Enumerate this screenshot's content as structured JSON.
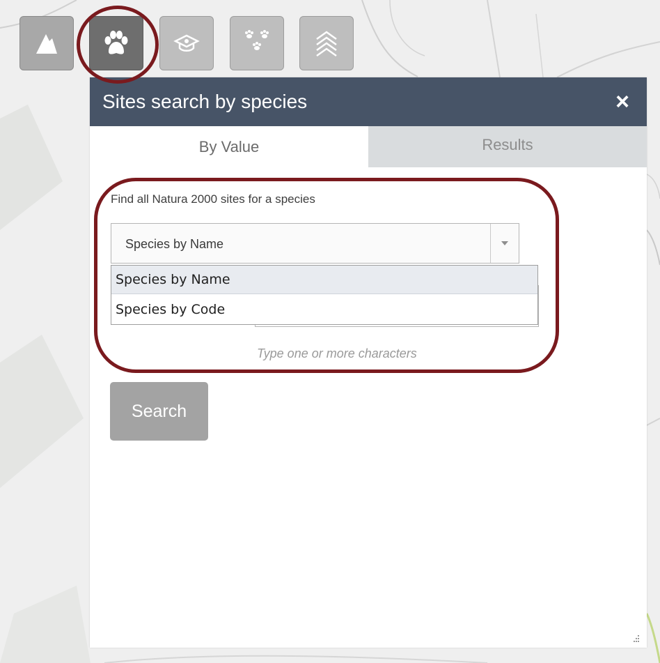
{
  "toolbar": {
    "tools": [
      {
        "icon": "mountain-icon",
        "active": false
      },
      {
        "icon": "paw-icon",
        "active": true
      },
      {
        "icon": "habitat-icon",
        "active": false
      },
      {
        "icon": "multi-paw-icon",
        "active": false
      },
      {
        "icon": "layers-icon",
        "active": false
      }
    ]
  },
  "panel": {
    "title": "Sites search by species",
    "close_label": "×",
    "tabs": [
      {
        "label": "By Value",
        "active": true
      },
      {
        "label": "Results",
        "active": false
      }
    ],
    "instruction": "Find all Natura 2000 sites for a species",
    "select": {
      "selected": "Species by Name",
      "options": [
        "Species by Name",
        "Species by Code"
      ],
      "highlighted_option": "Species by Name"
    },
    "hint": "Type one or more characters",
    "search_label": "Search"
  },
  "colors": {
    "header_bg": "#475467",
    "highlight": "#7a1a1e",
    "button_gray": "#a3a3a3",
    "inactive_tab_bg": "#d9dcde",
    "map_bg": "#efefef"
  }
}
